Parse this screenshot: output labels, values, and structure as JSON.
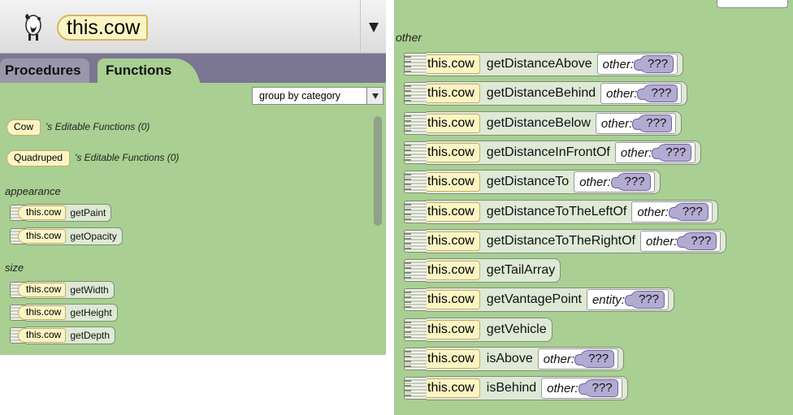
{
  "header": {
    "subject": "this.cow"
  },
  "tabs": [
    {
      "label": "Procedures"
    },
    {
      "label": "Functions"
    }
  ],
  "group_select": {
    "selected": "group by category"
  },
  "editable": [
    {
      "type": "Cow",
      "text": "'s Editable Functions (0)"
    },
    {
      "type": "Quadruped",
      "text": "'s Editable Functions (0)"
    }
  ],
  "categories": [
    {
      "label": "appearance",
      "items": [
        {
          "target": "this.cow",
          "method": "getPaint"
        },
        {
          "target": "this.cow",
          "method": "getOpacity"
        }
      ]
    },
    {
      "label": "size",
      "items": [
        {
          "target": "this.cow",
          "method": "getWidth"
        },
        {
          "target": "this.cow",
          "method": "getHeight"
        },
        {
          "target": "this.cow",
          "method": "getDepth"
        }
      ]
    }
  ],
  "right": {
    "category": "other",
    "items": [
      {
        "target": "this.cow",
        "method": "getDistanceAbove",
        "arg": "other:",
        "value": "???"
      },
      {
        "target": "this.cow",
        "method": "getDistanceBehind",
        "arg": "other:",
        "value": "???"
      },
      {
        "target": "this.cow",
        "method": "getDistanceBelow",
        "arg": "other:",
        "value": "???"
      },
      {
        "target": "this.cow",
        "method": "getDistanceInFrontOf",
        "arg": "other:",
        "value": "???"
      },
      {
        "target": "this.cow",
        "method": "getDistanceTo",
        "arg": "other:",
        "value": "???"
      },
      {
        "target": "this.cow",
        "method": "getDistanceToTheLeftOf",
        "arg": "other:",
        "value": "???"
      },
      {
        "target": "this.cow",
        "method": "getDistanceToTheRightOf",
        "arg": "other:",
        "value": "???"
      },
      {
        "target": "this.cow",
        "method": "getTailArray"
      },
      {
        "target": "this.cow",
        "method": "getVantagePoint",
        "arg": "entity:",
        "value": "???"
      },
      {
        "target": "this.cow",
        "method": "getVehicle"
      },
      {
        "target": "this.cow",
        "method": "isAbove",
        "arg": "other:",
        "value": "???"
      },
      {
        "target": "this.cow",
        "method": "isBehind",
        "arg": "other:",
        "value": "???"
      }
    ]
  }
}
